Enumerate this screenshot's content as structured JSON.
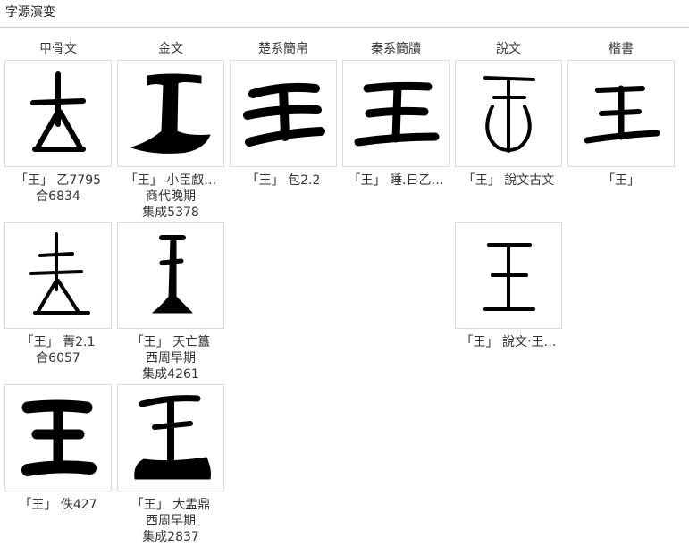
{
  "section": {
    "title": "字源演变"
  },
  "columns": [
    "甲骨文",
    "金文",
    "楚系簡帛",
    "秦系簡牘",
    "說文",
    "楷書"
  ],
  "cards": [
    {
      "id": "jgw1",
      "glyph": "jgw1",
      "lines": [
        "「王」 乙7795",
        "合6834"
      ]
    },
    {
      "id": "jw1",
      "glyph": "jw1",
      "lines": [
        "「王」 小臣𠭯…",
        "商代晚期",
        "集成5378"
      ]
    },
    {
      "id": "cx1",
      "glyph": "cx1",
      "lines": [
        "「王」 包2.2"
      ]
    },
    {
      "id": "qx1",
      "glyph": "qx1",
      "lines": [
        "「王」 睡.日乙…"
      ]
    },
    {
      "id": "sw1",
      "glyph": "sw1",
      "lines": [
        "「王」 說文古文"
      ]
    },
    {
      "id": "ks1",
      "glyph": "ks1",
      "lines": [
        "「王」"
      ]
    },
    {
      "id": "jgw2",
      "glyph": "jgw2",
      "lines": [
        "「王」 菁2.1",
        "合6057"
      ]
    },
    {
      "id": "jw2",
      "glyph": "jw2",
      "lines": [
        "「王」 天亡簋",
        "西周早期",
        "集成4261"
      ]
    },
    {
      "id": "sw2",
      "glyph": "sw2",
      "lines": [
        "「王」 說文‧王…"
      ]
    },
    {
      "id": "jgw3",
      "glyph": "jgw3",
      "lines": [
        "「王」 佚427"
      ]
    },
    {
      "id": "jw3",
      "glyph": "jw3",
      "lines": [
        "「王」 大盂鼎",
        "西周早期",
        "集成2837"
      ]
    }
  ]
}
